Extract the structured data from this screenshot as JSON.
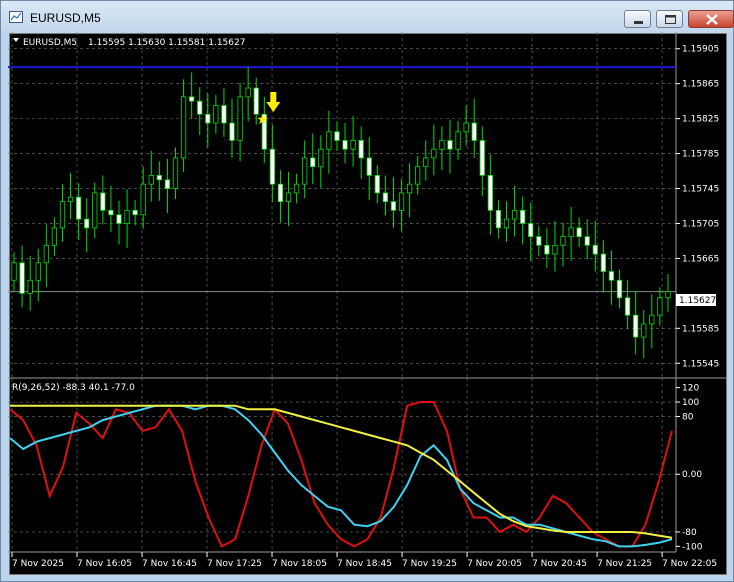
{
  "window": {
    "title": "EURUSD,M5",
    "minimize_label": "minimize",
    "maximize_label": "maximize",
    "close_label": "close"
  },
  "chart_data": [
    {
      "type": "candlestick",
      "symbol_label": "EURUSD,M5",
      "ohlc_label": "1.15595 1.15630 1.15581 1.15627",
      "current_price_label": "1.15627",
      "ylim": [
        1.15535,
        1.15915
      ],
      "y_ticks": [
        "1.15905",
        "1.15865",
        "1.15825",
        "1.15785",
        "1.15745",
        "1.15705",
        "1.15665",
        "1.15585",
        "1.15545"
      ],
      "x_ticks": [
        "7 Nov 2025",
        "7 Nov 16:05",
        "7 Nov 16:45",
        "7 Nov 17:25",
        "7 Nov 18:05",
        "7 Nov 18:45",
        "7 Nov 19:25",
        "7 Nov 20:05",
        "7 Nov 20:45",
        "7 Nov 21:25",
        "7 Nov 22:05"
      ],
      "horizontal_line": 1.15884,
      "current_price": 1.15627,
      "arrow_signal_index": 31,
      "colors": {
        "bull": "#000000",
        "bear": "#ffffff",
        "wick": "#00dd00",
        "hline": "#1b1bd1",
        "price_line": "#888888",
        "signal": "#ffee00"
      },
      "closes": [
        1.1566,
        1.15625,
        1.1564,
        1.1566,
        1.1568,
        1.157,
        1.1573,
        1.15735,
        1.1571,
        1.157,
        1.1574,
        1.1572,
        1.15715,
        1.15705,
        1.1572,
        1.15715,
        1.1575,
        1.1576,
        1.15755,
        1.15745,
        1.1578,
        1.1585,
        1.15845,
        1.1583,
        1.1582,
        1.1584,
        1.1582,
        1.158,
        1.1585,
        1.1586,
        1.1583,
        1.1579,
        1.1575,
        1.1573,
        1.1574,
        1.1575,
        1.1578,
        1.1577,
        1.1579,
        1.1581,
        1.158,
        1.1579,
        1.158,
        1.1578,
        1.1576,
        1.1574,
        1.1573,
        1.1572,
        1.1574,
        1.1575,
        1.1577,
        1.1578,
        1.1579,
        1.158,
        1.1579,
        1.1581,
        1.1582,
        1.158,
        1.1576,
        1.1572,
        1.157,
        1.1571,
        1.1572,
        1.15705,
        1.1569,
        1.1568,
        1.1567,
        1.1568,
        1.1569,
        1.157,
        1.1569,
        1.1568,
        1.1567,
        1.1565,
        1.1564,
        1.1562,
        1.156,
        1.15575,
        1.1559,
        1.156,
        1.1562,
        1.15627
      ]
    },
    {
      "type": "line",
      "indicator_label": "R(9,26,52) -88.3 40.1 -77.0",
      "ylim": [
        -105,
        125
      ],
      "y_ticks": [
        "120",
        "100",
        "80",
        "0.00",
        "-80",
        "-100"
      ],
      "series_colors": [
        "#e01010",
        "#40d0f0",
        "#f0f040"
      ],
      "red": [
        90,
        75,
        40,
        -30,
        10,
        85,
        70,
        50,
        90,
        85,
        60,
        65,
        90,
        60,
        -10,
        -60,
        -100,
        -90,
        -30,
        40,
        90,
        70,
        20,
        -40,
        -70,
        -90,
        -100,
        -90,
        -60,
        10,
        95,
        100,
        100,
        60,
        -20,
        -60,
        -60,
        -80,
        -70,
        -80,
        -60,
        -30,
        -40,
        -60,
        -80,
        -90,
        -100,
        -100,
        -70,
        -10,
        60
      ],
      "cyan": [
        50,
        35,
        45,
        50,
        55,
        60,
        65,
        75,
        80,
        85,
        90,
        95,
        95,
        95,
        90,
        95,
        95,
        90,
        75,
        55,
        30,
        5,
        -15,
        -30,
        -45,
        -50,
        -70,
        -72,
        -65,
        -45,
        -15,
        25,
        40,
        20,
        -20,
        -40,
        -50,
        -60,
        -60,
        -70,
        -70,
        -75,
        -80,
        -85,
        -90,
        -93,
        -100,
        -100,
        -98,
        -95,
        -90
      ],
      "yellow": [
        95,
        95,
        95,
        95,
        95,
        95,
        95,
        95,
        95,
        95,
        95,
        95,
        95,
        95,
        95,
        95,
        95,
        95,
        90,
        90,
        90,
        85,
        80,
        75,
        70,
        65,
        60,
        55,
        50,
        45,
        40,
        30,
        20,
        5,
        -10,
        -25,
        -40,
        -55,
        -65,
        -72,
        -75,
        -78,
        -80,
        -80,
        -80,
        -80,
        -80,
        -80,
        -82,
        -85,
        -88
      ]
    }
  ]
}
